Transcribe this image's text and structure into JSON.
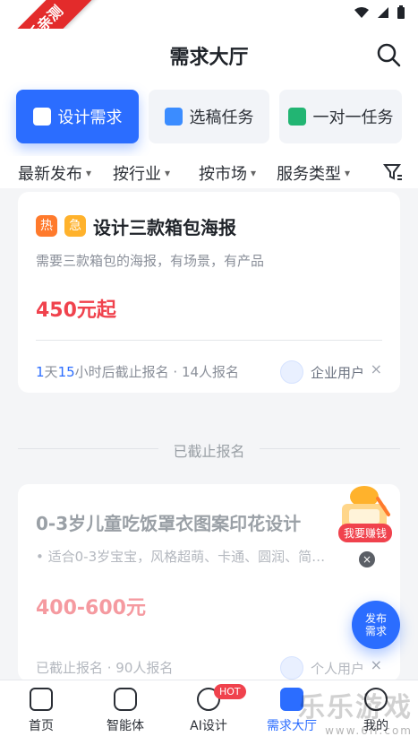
{
  "ribbon": {
    "text": "乐乐亲测"
  },
  "header": {
    "title": "需求大厅"
  },
  "tabs": [
    {
      "label": "设计需求",
      "icon": "design-doc-icon",
      "active": true
    },
    {
      "label": "选稿任务",
      "icon": "pick-draft-icon",
      "active": false
    },
    {
      "label": "一对一任务",
      "icon": "one-to-one-icon",
      "active": false
    }
  ],
  "filters": [
    {
      "label": "最新发布"
    },
    {
      "label": "按行业"
    },
    {
      "label": "按市场"
    },
    {
      "label": "服务类型"
    }
  ],
  "card1": {
    "badges": [
      "热",
      "急"
    ],
    "title": "设计三款箱包海报",
    "desc": "需要三款箱包的海报，有场景，有产品",
    "price": "450元起",
    "deadline_days": "1",
    "deadline_day_unit": "天",
    "deadline_hours": "15",
    "deadline_suffix": "小时后截止报名 · 14人报名",
    "user_type": "企业用户"
  },
  "section": {
    "closed_label": "已截止报名"
  },
  "card2": {
    "title": "0-3岁儿童吃饭罩衣图案印花设计",
    "desc": "• 适合0-3岁宝宝，风格超萌、卡通、圆润、简…",
    "price": "400-600元",
    "meta": "已截止报名 · 90人报名",
    "user_type": "个人用户"
  },
  "earn": {
    "label": "我要赚钱"
  },
  "publish": {
    "line1": "发布",
    "line2": "需求"
  },
  "bottom_nav": {
    "items": [
      {
        "label": "首页"
      },
      {
        "label": "智能体"
      },
      {
        "label": "AI设计",
        "tag": "HOT"
      },
      {
        "label": "需求大厅"
      },
      {
        "label": "我的"
      }
    ]
  },
  "watermark": {
    "main": "乐乐游戏",
    "sub": "www.6li.com"
  },
  "colors": {
    "primary": "#2b6dff",
    "price": "#f0424d"
  }
}
